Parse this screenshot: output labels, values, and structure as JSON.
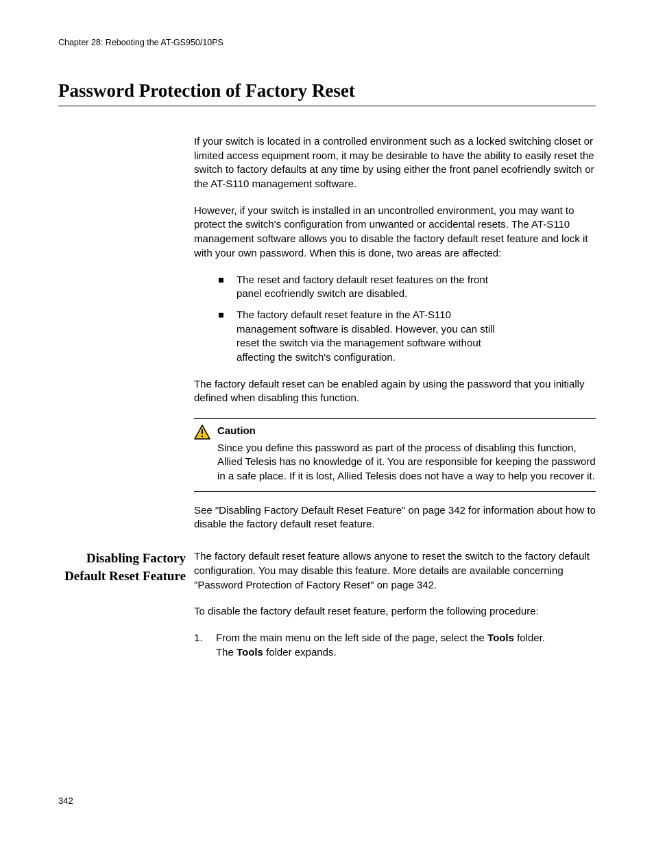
{
  "header": {
    "chapter": "Chapter 28: Rebooting the AT-GS950/10PS"
  },
  "title": "Password Protection of Factory Reset",
  "para1": "If your switch is located in a controlled environment such as a locked switching closet or limited access equipment room, it may be desirable to have the ability to easily reset the switch to factory defaults at any time by using either the front panel ecofriendly switch or the AT-S110 management software.",
  "para2": "However, if your switch is installed in an uncontrolled environment, you may want to protect the switch's configuration from unwanted or accidental resets. The AT-S110 management software allows you to disable the factory default reset feature and lock it with your own password. When this is done, two areas are affected:",
  "bullets": [
    "The reset and factory default reset features on the front panel ecofriendly switch are disabled.",
    "The factory default reset feature in the AT-S110 management software is disabled. However, you can still reset the switch via the management software without affecting the switch's configuration."
  ],
  "para3": "The factory default reset can be enabled again by using the password that you initially defined when disabling this function.",
  "caution": {
    "label": "Caution",
    "text": "Since you define this password as part of the process of disabling this function, Allied Telesis has no knowledge of it. You are responsible for keeping the password in a safe place. If it is lost, Allied Telesis does not have a way to help you recover it."
  },
  "para4": "See \"Disabling Factory Default Reset Feature\" on page 342 for information about how to disable the factory default reset feature.",
  "subsection": {
    "heading": "Disabling Factory Default Reset Feature",
    "p1": "The factory default reset feature allows anyone to reset the switch to the factory default configuration. You may disable this feature. More details are available concerning \"Password Protection of Factory Reset\" on page 342.",
    "p2": "To disable the factory default reset feature, perform the following procedure:",
    "step1_num": "1.",
    "step1_a": "From the main menu on the left side of the page, select the ",
    "step1_bold1": "Tools",
    "step1_b": " folder.",
    "step1_c": "The ",
    "step1_bold2": "Tools",
    "step1_d": " folder expands."
  },
  "pageNumber": "342"
}
